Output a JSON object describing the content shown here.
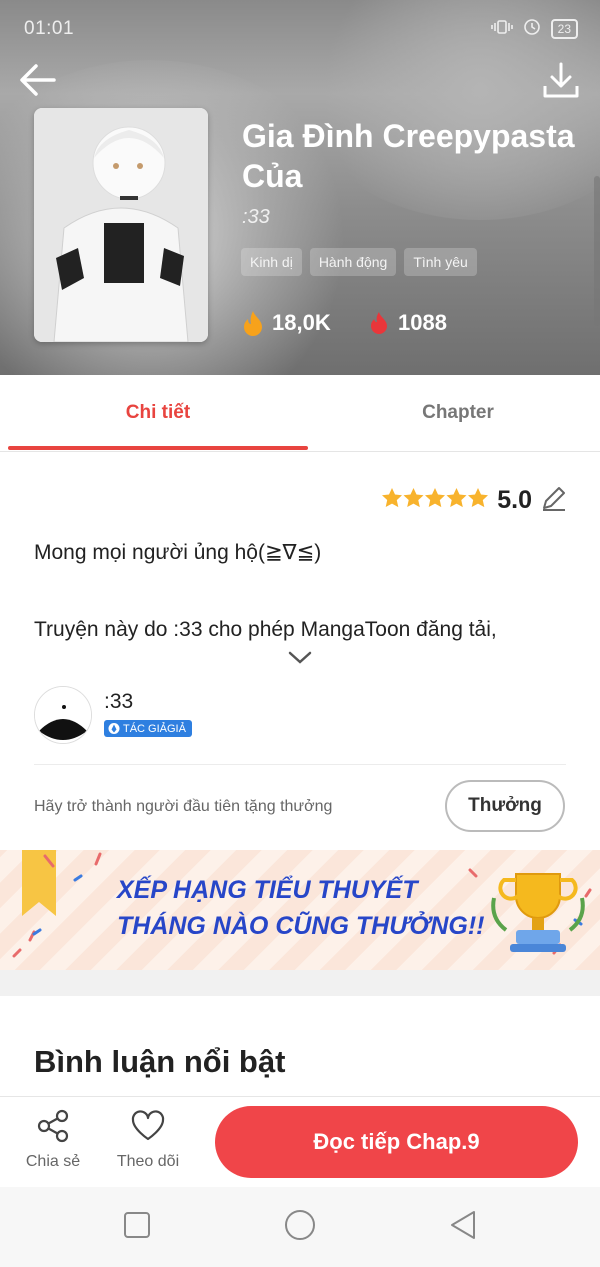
{
  "status_bar": {
    "time": "01:01",
    "battery": "23"
  },
  "header": {
    "title": "Gia Đình Creepypasta Của",
    "author": ":33",
    "tags": [
      "Kinh dị",
      "Hành động",
      "Tình yêu"
    ],
    "views": "18,0K",
    "likes": "1088"
  },
  "tabs": [
    {
      "label": "Chi tiết",
      "active": true
    },
    {
      "label": "Chapter",
      "active": false
    }
  ],
  "details": {
    "rating": "5.0",
    "stars": 5,
    "description_line1": "Mong mọi người ủng hộ(≧∇≦)",
    "description_line2": "Truyện này do :33 cho phép MangaToon đăng tải,",
    "author_name": ":33",
    "author_badge": "TÁC GIẢGIẢ",
    "reward_prompt": "Hãy trở thành người đầu tiên tặng thưởng",
    "reward_button": "Thưởng"
  },
  "banner": {
    "line1": "XẾP HẠNG TIỂU THUYẾT",
    "line2": "THÁNG NÀO CŨNG THƯỞNG!!"
  },
  "comments": {
    "title": "Bình luận nổi bật"
  },
  "bottom_bar": {
    "share_label": "Chia sẻ",
    "follow_label": "Theo dõi",
    "continue_label": "Đọc tiếp Chap.9"
  },
  "colors": {
    "accent": "#e8443f",
    "button_red": "#f04549",
    "star": "#f8b32d",
    "banner_text": "#2746c8",
    "badge_blue": "#2e7fe0"
  }
}
